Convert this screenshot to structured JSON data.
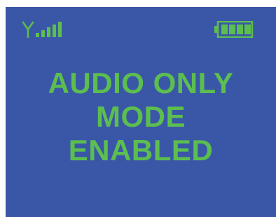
{
  "colors": {
    "background": "#3a57a7",
    "accent": "#5cbe4f"
  },
  "status_bar": {
    "signal_icon": "signal-strength-icon",
    "signal_bars_filled": 5,
    "signal_bars_total": 5,
    "battery_icon": "battery-icon",
    "battery_level": 1.0
  },
  "message": {
    "line1": "AUDIO ONLY",
    "line2": "MODE",
    "line3": "ENABLED"
  }
}
